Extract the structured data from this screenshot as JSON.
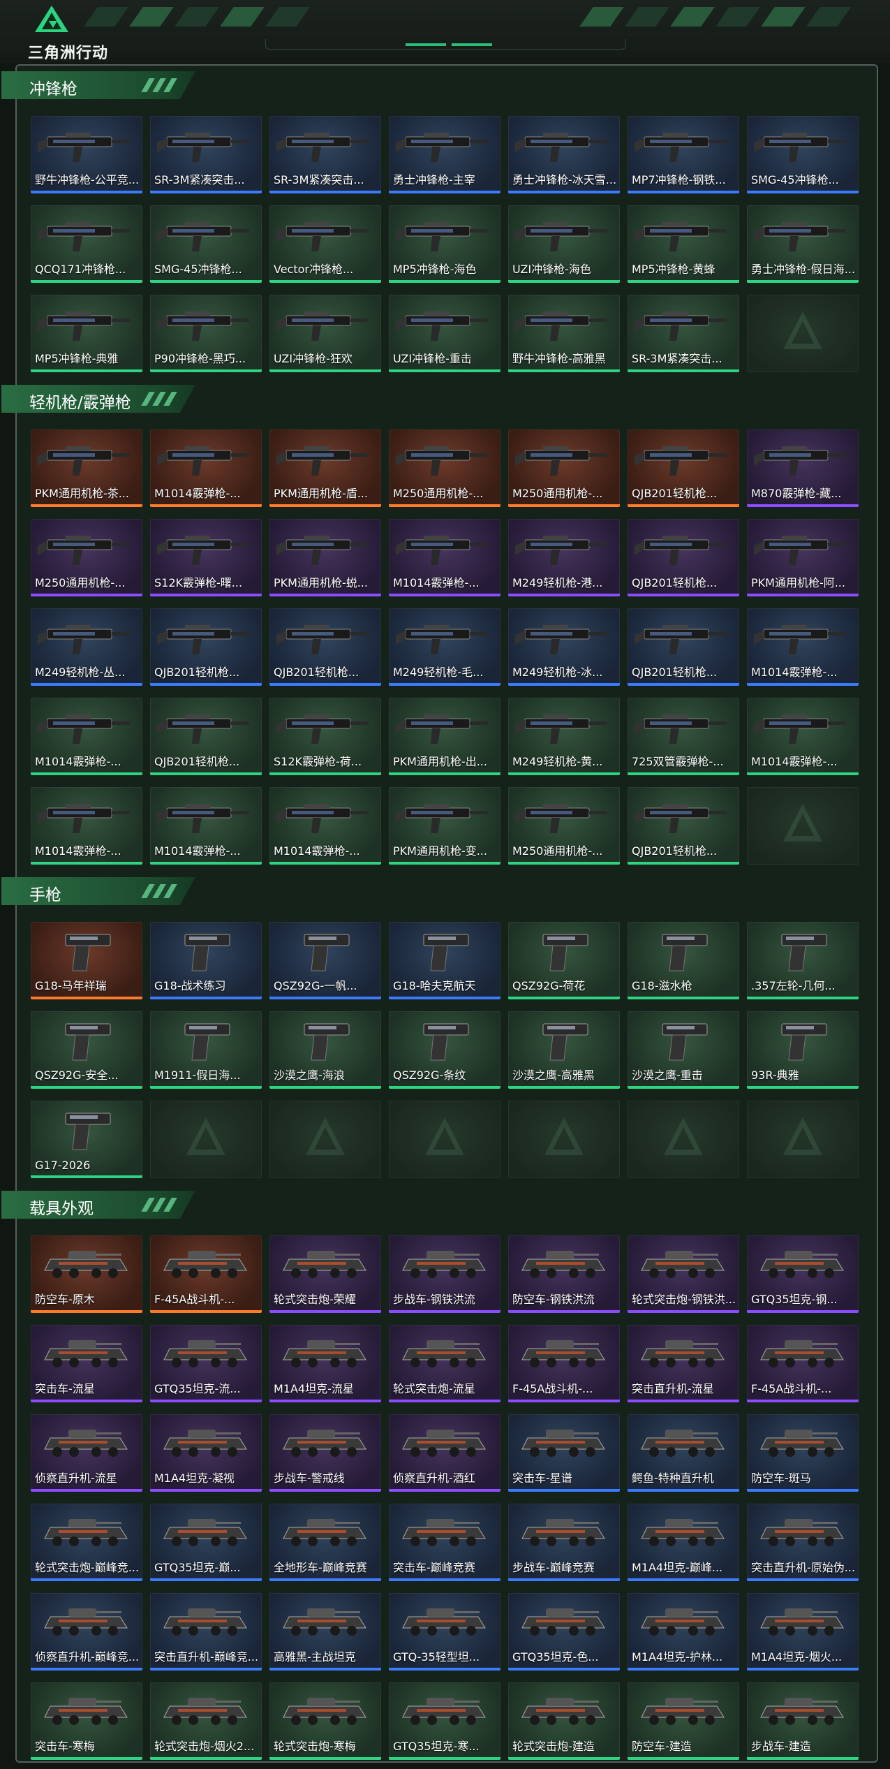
{
  "app_title": "三角洲行动",
  "colors": {
    "rarity_green": "#2ed483",
    "rarity_blue": "#3b7bff",
    "rarity_purple": "#8b4dff",
    "rarity_orange": "#ff7a2a",
    "accent": "#2bbf7a"
  },
  "sections": [
    {
      "title": "冲锋枪",
      "kind": "gun",
      "items": [
        {
          "name": "野牛冲锋枪-公平竞...",
          "rarity": "blue"
        },
        {
          "name": "SR-3M紧凑突击...",
          "rarity": "blue"
        },
        {
          "name": "SR-3M紧凑突击...",
          "rarity": "blue"
        },
        {
          "name": "勇士冲锋枪-主宰",
          "rarity": "blue"
        },
        {
          "name": "勇士冲锋枪-冰天雪...",
          "rarity": "blue"
        },
        {
          "name": "MP7冲锋枪-钢铁...",
          "rarity": "blue"
        },
        {
          "name": "SMG-45冲锋枪...",
          "rarity": "blue"
        },
        {
          "name": "QCQ171冲锋枪...",
          "rarity": "green"
        },
        {
          "name": "SMG-45冲锋枪...",
          "rarity": "green"
        },
        {
          "name": "Vector冲锋枪...",
          "rarity": "green"
        },
        {
          "name": "MP5冲锋枪-海色",
          "rarity": "green"
        },
        {
          "name": "UZI冲锋枪-海色",
          "rarity": "green"
        },
        {
          "name": "MP5冲锋枪-黄蜂",
          "rarity": "green"
        },
        {
          "name": "勇士冲锋枪-假日海...",
          "rarity": "green"
        },
        {
          "name": "MP5冲锋枪-典雅",
          "rarity": "green"
        },
        {
          "name": "P90冲锋枪-黑巧...",
          "rarity": "green"
        },
        {
          "name": "UZI冲锋枪-狂欢",
          "rarity": "green"
        },
        {
          "name": "UZI冲锋枪-重击",
          "rarity": "green"
        },
        {
          "name": "野牛冲锋枪-高雅黑",
          "rarity": "green"
        },
        {
          "name": "SR-3M紧凑突击...",
          "rarity": "green"
        },
        {
          "name": "",
          "rarity": "empty"
        }
      ]
    },
    {
      "title": "轻机枪/霰弹枪",
      "kind": "gun",
      "items": [
        {
          "name": "PKM通用机枪-茶...",
          "rarity": "orange"
        },
        {
          "name": "M1014霰弹枪-...",
          "rarity": "orange"
        },
        {
          "name": "PKM通用机枪-盾...",
          "rarity": "orange"
        },
        {
          "name": "M250通用机枪-...",
          "rarity": "orange"
        },
        {
          "name": "M250通用机枪-...",
          "rarity": "orange"
        },
        {
          "name": "QJB201轻机枪...",
          "rarity": "orange"
        },
        {
          "name": "M870霰弹枪-藏...",
          "rarity": "purple"
        },
        {
          "name": "M250通用机枪-...",
          "rarity": "purple"
        },
        {
          "name": "S12K霰弹枪-曙...",
          "rarity": "purple"
        },
        {
          "name": "PKM通用机枪-蜕...",
          "rarity": "purple"
        },
        {
          "name": "M1014霰弹枪-...",
          "rarity": "purple"
        },
        {
          "name": "M249轻机枪-港...",
          "rarity": "purple"
        },
        {
          "name": "QJB201轻机枪...",
          "rarity": "purple"
        },
        {
          "name": "PKM通用机枪-阿...",
          "rarity": "purple"
        },
        {
          "name": "M249轻机枪-丛...",
          "rarity": "blue"
        },
        {
          "name": "QJB201轻机枪...",
          "rarity": "blue"
        },
        {
          "name": "QJB201轻机枪...",
          "rarity": "blue"
        },
        {
          "name": "M249轻机枪-毛...",
          "rarity": "blue"
        },
        {
          "name": "M249轻机枪-冰...",
          "rarity": "blue"
        },
        {
          "name": "QJB201轻机枪...",
          "rarity": "blue"
        },
        {
          "name": "M1014霰弹枪-...",
          "rarity": "blue"
        },
        {
          "name": "M1014霰弹枪-...",
          "rarity": "green"
        },
        {
          "name": "QJB201轻机枪...",
          "rarity": "green"
        },
        {
          "name": "S12K霰弹枪-荷...",
          "rarity": "green"
        },
        {
          "name": "PKM通用机枪-出...",
          "rarity": "green"
        },
        {
          "name": "M249轻机枪-黄...",
          "rarity": "green"
        },
        {
          "name": "725双管霰弹枪-...",
          "rarity": "green"
        },
        {
          "name": "M1014霰弹枪-...",
          "rarity": "green"
        },
        {
          "name": "M1014霰弹枪-...",
          "rarity": "green"
        },
        {
          "name": "M1014霰弹枪-...",
          "rarity": "green"
        },
        {
          "name": "M1014霰弹枪-...",
          "rarity": "green"
        },
        {
          "name": "PKM通用机枪-变...",
          "rarity": "green"
        },
        {
          "name": "M250通用机枪-...",
          "rarity": "green"
        },
        {
          "name": "QJB201轻机枪...",
          "rarity": "green"
        },
        {
          "name": "",
          "rarity": "empty"
        }
      ]
    },
    {
      "title": "手枪",
      "kind": "pistol",
      "items": [
        {
          "name": "G18-马年祥瑞",
          "rarity": "orange"
        },
        {
          "name": "G18-战术练习",
          "rarity": "blue"
        },
        {
          "name": "QSZ92G-一帆...",
          "rarity": "blue"
        },
        {
          "name": "G18-哈夫克航天",
          "rarity": "blue"
        },
        {
          "name": "QSZ92G-荷花",
          "rarity": "green"
        },
        {
          "name": "G18-滋水枪",
          "rarity": "green"
        },
        {
          "name": ".357左轮-几何...",
          "rarity": "green"
        },
        {
          "name": "QSZ92G-安全...",
          "rarity": "green"
        },
        {
          "name": "M1911-假日海...",
          "rarity": "green"
        },
        {
          "name": "沙漠之鹰-海浪",
          "rarity": "green"
        },
        {
          "name": "QSZ92G-条纹",
          "rarity": "green"
        },
        {
          "name": "沙漠之鹰-高雅黑",
          "rarity": "green"
        },
        {
          "name": "沙漠之鹰-重击",
          "rarity": "green"
        },
        {
          "name": "93R-典雅",
          "rarity": "green"
        },
        {
          "name": "G17-2026",
          "rarity": "green"
        },
        {
          "name": "",
          "rarity": "empty"
        },
        {
          "name": "",
          "rarity": "empty"
        },
        {
          "name": "",
          "rarity": "empty"
        },
        {
          "name": "",
          "rarity": "empty"
        },
        {
          "name": "",
          "rarity": "empty"
        },
        {
          "name": "",
          "rarity": "empty"
        }
      ]
    },
    {
      "title": "载具外观",
      "kind": "vehicle",
      "items": [
        {
          "name": "防空车-原木",
          "rarity": "orange"
        },
        {
          "name": "F-45A战斗机-...",
          "rarity": "orange"
        },
        {
          "name": "轮式突击炮-荣耀",
          "rarity": "purple"
        },
        {
          "name": "步战车-钢铁洪流",
          "rarity": "purple"
        },
        {
          "name": "防空车-钢铁洪流",
          "rarity": "purple"
        },
        {
          "name": "轮式突击炮-钢铁洪...",
          "rarity": "purple"
        },
        {
          "name": "GTQ35坦克-钢...",
          "rarity": "purple"
        },
        {
          "name": "突击车-流星",
          "rarity": "purple"
        },
        {
          "name": "GTQ35坦克-流...",
          "rarity": "purple"
        },
        {
          "name": "M1A4坦克-流星",
          "rarity": "purple"
        },
        {
          "name": "轮式突击炮-流星",
          "rarity": "purple"
        },
        {
          "name": "F-45A战斗机-...",
          "rarity": "purple"
        },
        {
          "name": "突击直升机-流星",
          "rarity": "purple"
        },
        {
          "name": "F-45A战斗机-...",
          "rarity": "purple"
        },
        {
          "name": "侦察直升机-流星",
          "rarity": "purple"
        },
        {
          "name": "M1A4坦克-凝视",
          "rarity": "purple"
        },
        {
          "name": "步战车-警戒线",
          "rarity": "purple"
        },
        {
          "name": "侦察直升机-酒红",
          "rarity": "purple"
        },
        {
          "name": "突击车-星谱",
          "rarity": "blue"
        },
        {
          "name": "鳄鱼-特种直升机",
          "rarity": "blue"
        },
        {
          "name": "防空车-斑马",
          "rarity": "blue"
        },
        {
          "name": "轮式突击炮-巅峰竞...",
          "rarity": "blue"
        },
        {
          "name": "GTQ35坦克-巅...",
          "rarity": "blue"
        },
        {
          "name": "全地形车-巅峰竞赛",
          "rarity": "blue"
        },
        {
          "name": "突击车-巅峰竞赛",
          "rarity": "blue"
        },
        {
          "name": "步战车-巅峰竞赛",
          "rarity": "blue"
        },
        {
          "name": "M1A4坦克-巅峰...",
          "rarity": "blue"
        },
        {
          "name": "突击直升机-原始伪...",
          "rarity": "blue"
        },
        {
          "name": "侦察直升机-巅峰竞...",
          "rarity": "blue"
        },
        {
          "name": "突击直升机-巅峰竞...",
          "rarity": "blue"
        },
        {
          "name": "高雅黑-主战坦克",
          "rarity": "blue"
        },
        {
          "name": "GTQ-35轻型坦...",
          "rarity": "blue"
        },
        {
          "name": "GTQ35坦克-色...",
          "rarity": "blue"
        },
        {
          "name": "M1A4坦克-护林...",
          "rarity": "blue"
        },
        {
          "name": "M1A4坦克-烟火...",
          "rarity": "blue"
        },
        {
          "name": "突击车-寒梅",
          "rarity": "green"
        },
        {
          "name": "轮式突击炮-烟火2...",
          "rarity": "green"
        },
        {
          "name": "轮式突击炮-寒梅",
          "rarity": "green"
        },
        {
          "name": "GTQ35坦克-寒...",
          "rarity": "green"
        },
        {
          "name": "轮式突击炮-建造",
          "rarity": "green"
        },
        {
          "name": "防空车-建造",
          "rarity": "green"
        },
        {
          "name": "步战车-建造",
          "rarity": "green"
        }
      ]
    }
  ]
}
